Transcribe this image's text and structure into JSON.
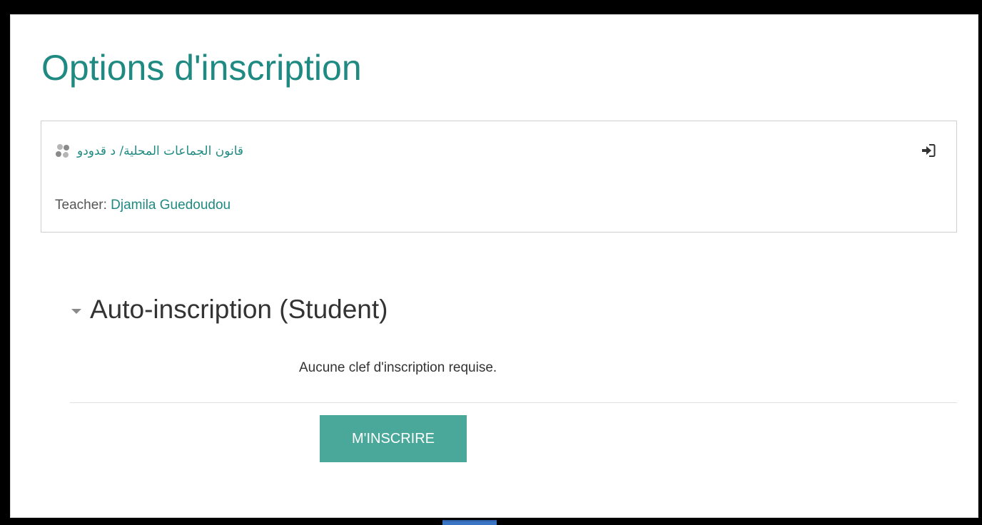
{
  "page": {
    "title": "Options d'inscription"
  },
  "course": {
    "name": "قانون الجماعات المحلية/ د قدودو",
    "course_icon": "course-cluster-icon",
    "enter_icon": "sign-in-icon",
    "teacher_label": "Teacher:",
    "teacher_name": "Djamila Guedoudou"
  },
  "self_enrolment": {
    "section_title": "Auto-inscription (Student)",
    "section_icon": "chevron-down-icon",
    "info": "Aucune clef d'inscription requise.",
    "button_label": "M'INSCRIRE"
  },
  "colors": {
    "accent_text": "#1f8a82",
    "button_bg": "#4aa89a",
    "frame": "#000000"
  }
}
